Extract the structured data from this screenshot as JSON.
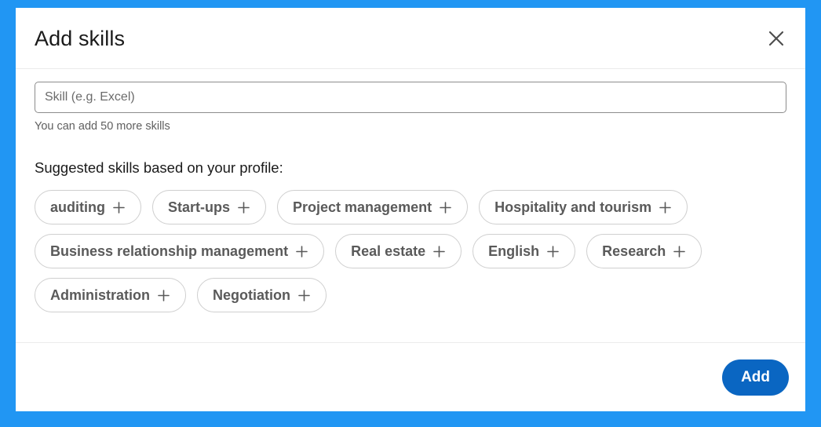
{
  "theme": {
    "frame_color": "#2196f3",
    "dialog_background": "#ffffff",
    "accent_color": "#0a66c2",
    "pill_border_color": "#cfcfcf",
    "pill_text_color": "#5a5a5a",
    "divider_color": "#ebebeb"
  },
  "dialog": {
    "title": "Add skills",
    "close_icon": "close-icon",
    "close_label": "Close"
  },
  "form": {
    "skill_input": {
      "value": "",
      "placeholder": "Skill (e.g. Excel)"
    },
    "helper_text": "You can add 50 more skills"
  },
  "suggestions": {
    "heading": "Suggested skills based on your profile:",
    "add_icon": "plus-icon",
    "items": [
      {
        "label": "auditing"
      },
      {
        "label": "Start-ups"
      },
      {
        "label": "Project management"
      },
      {
        "label": "Hospitality and tourism"
      },
      {
        "label": "Business relationship management"
      },
      {
        "label": "Real estate"
      },
      {
        "label": "English"
      },
      {
        "label": "Research"
      },
      {
        "label": "Administration"
      },
      {
        "label": "Negotiation"
      }
    ]
  },
  "footer": {
    "add_label": "Add"
  }
}
